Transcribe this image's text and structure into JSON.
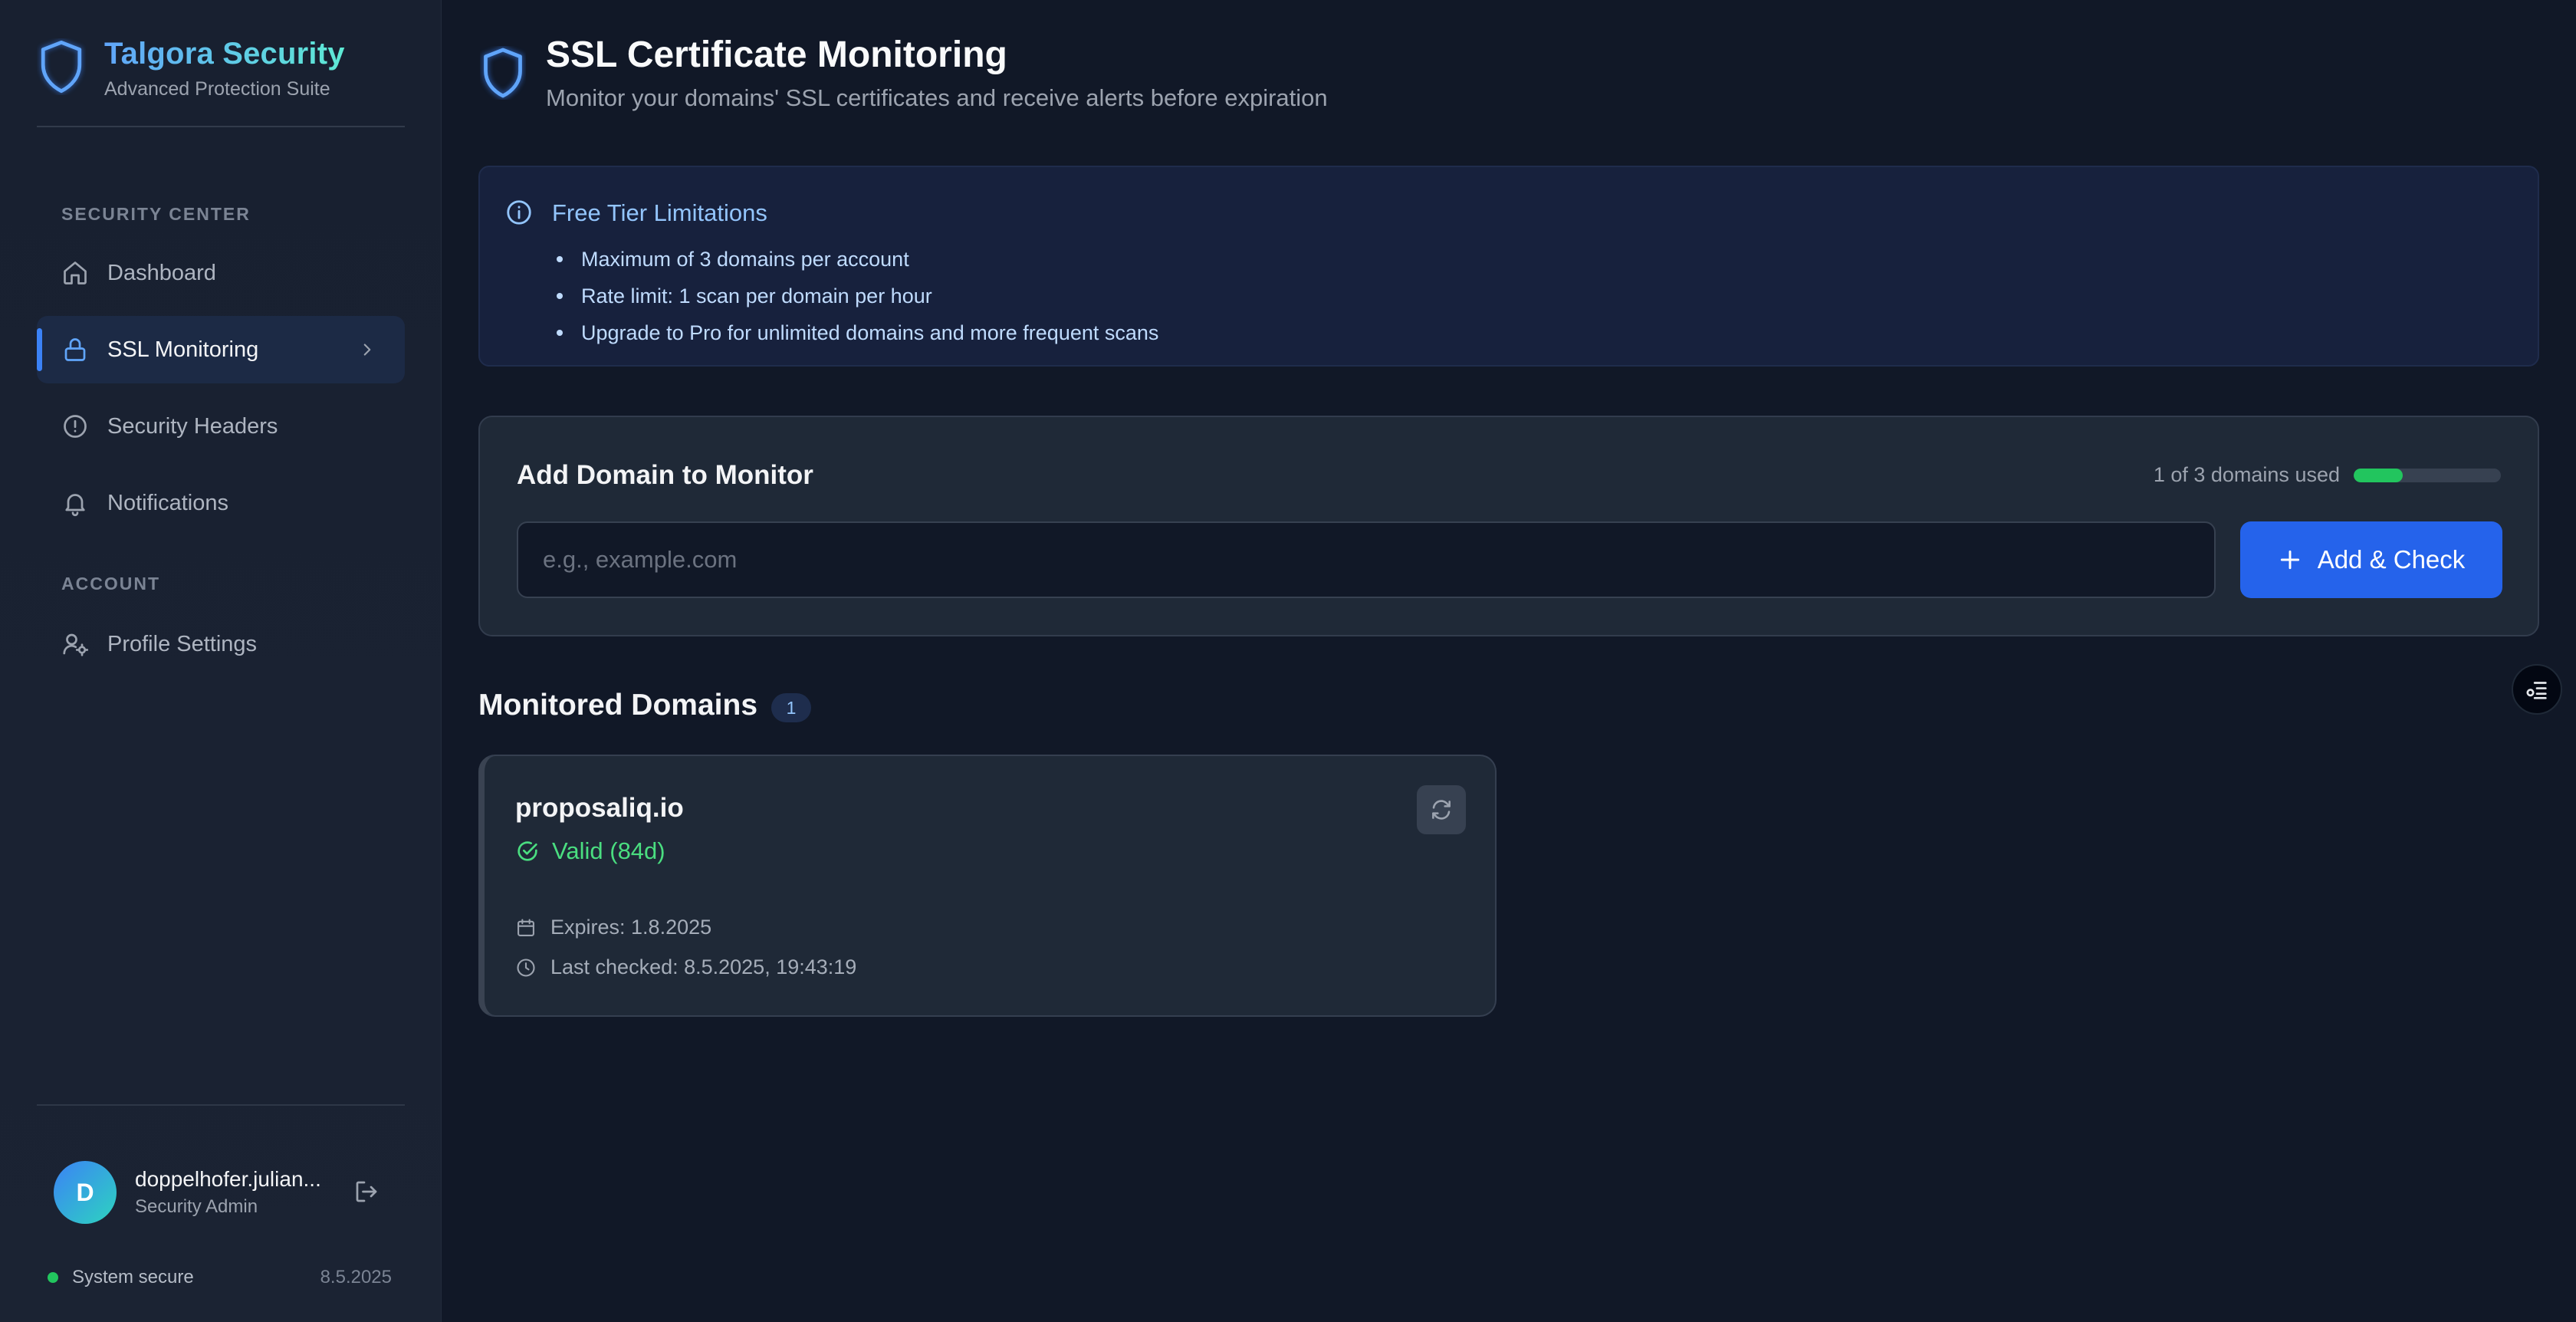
{
  "brand": {
    "title": "Talgora Security",
    "subtitle": "Advanced Protection Suite",
    "icon": "shield-icon"
  },
  "sidebar": {
    "sections": [
      {
        "label": "SECURITY CENTER",
        "items": [
          {
            "label": "Dashboard",
            "icon": "home-icon",
            "active": false
          },
          {
            "label": "SSL Monitoring",
            "icon": "lock-icon",
            "active": true
          },
          {
            "label": "Security Headers",
            "icon": "alert-circle-icon",
            "active": false
          },
          {
            "label": "Notifications",
            "icon": "bell-icon",
            "active": false
          }
        ]
      },
      {
        "label": "ACCOUNT",
        "items": [
          {
            "label": "Profile Settings",
            "icon": "user-cog-icon",
            "active": false
          }
        ]
      }
    ]
  },
  "user": {
    "initial": "D",
    "name": "doppelhofer.julian...",
    "role": "Security Admin"
  },
  "system": {
    "status": "System secure",
    "date": "8.5.2025",
    "status_color": "#22c55e"
  },
  "header": {
    "title": "SSL Certificate Monitoring",
    "subtitle": "Monitor your domains' SSL certificates and receive alerts before expiration"
  },
  "info": {
    "title": "Free Tier Limitations",
    "items": [
      "Maximum of 3 domains per account",
      "Rate limit: 1 scan per domain per hour",
      "Upgrade to Pro for unlimited domains and more frequent scans"
    ]
  },
  "add_domain": {
    "title": "Add Domain to Monitor",
    "usage_text": "1 of 3 domains used",
    "usage_used": 1,
    "usage_max": 3,
    "input_value": "",
    "placeholder": "e.g., example.com",
    "button_label": "Add & Check"
  },
  "monitored": {
    "title": "Monitored Domains",
    "count": "1",
    "domains": [
      {
        "name": "proposaliq.io",
        "status": "Valid (84d)",
        "expires": "Expires: 1.8.2025",
        "last_checked": "Last checked: 8.5.2025, 19:43:19"
      }
    ]
  },
  "colors": {
    "accent": "#2563eb",
    "valid": "#4ade80",
    "background": "#111827"
  }
}
